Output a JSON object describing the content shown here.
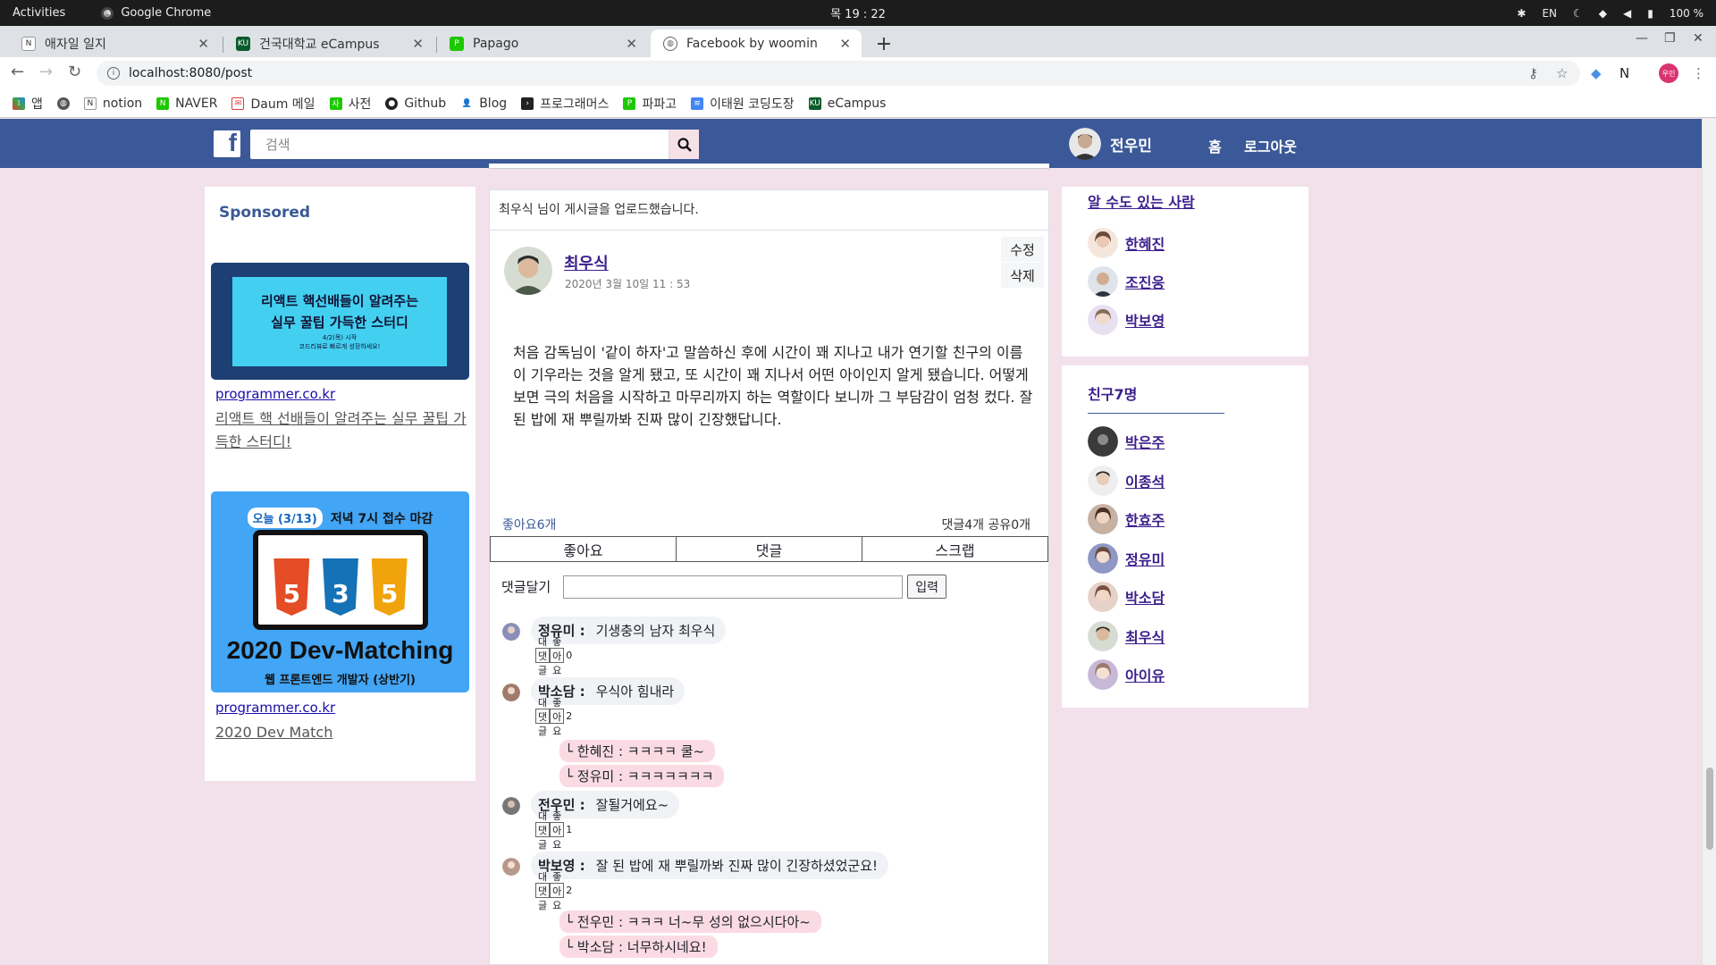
{
  "system": {
    "activities": "Activities",
    "app": "Google Chrome",
    "clock": "목 19 : 22",
    "lang": "EN",
    "battery": "100 %"
  },
  "tabs": [
    {
      "title": "애자일 일지",
      "fav": "notion"
    },
    {
      "title": "건국대학교 eCampus",
      "fav": "KU"
    },
    {
      "title": "Papago",
      "fav": "P"
    },
    {
      "title": "Facebook by woomin",
      "fav": "globe"
    }
  ],
  "address": {
    "url": "localhost:8080/post"
  },
  "bookmarks": [
    "앱",
    "notion",
    "NAVER",
    "Daum 메일",
    "사전",
    "Github",
    "Blog",
    "프로그래머스",
    "파파고",
    "이태원 코딩도장",
    "eCampus"
  ],
  "header": {
    "logo": "f",
    "search_placeholder": "검색",
    "user_name": "전우민",
    "nav_home": "홈",
    "nav_logout": "로그아웃"
  },
  "sponsored": {
    "title": "Sponsored",
    "ads": [
      {
        "banner_line1": "리액트 핵선배들이 알려주는",
        "banner_line2": "실무 꿀팁 가득한 스터디",
        "banner_small1": "4/2(목) 시작",
        "banner_small2": "코드리뷰로 빠르게 성장하세요!",
        "link": "programmer.co.kr",
        "desc": "리액트 핵 선배들이 알려주는 실무 꿀팁 가득한 스터디!"
      },
      {
        "banner_pill": "오늘 (3/13)",
        "banner_deadline": "저녁 7시 접수 마감",
        "badges": [
          "HTML",
          "CSS",
          "JS"
        ],
        "banner_big": "2020 Dev-Matching",
        "banner_sub": "웹 프론트엔드 개발자 (상반기)",
        "link": "programmer.co.kr",
        "desc": "2020 Dev Match"
      }
    ]
  },
  "post": {
    "notice": "최우식 님이 게시글을 업로드했습니다.",
    "author": "최우식",
    "date": "2020년 3월 10일    11 : 53",
    "edit": "수정",
    "delete": "삭제",
    "body": "처음 감독님이 '같이 하자'고 말씀하신 후에 시간이 꽤 지나고 내가 연기할 친구의 이름이 기우라는 것을 알게 됐고, 또 시간이 꽤 지나서 어떤 아이인지 알게 됐습니다. 어떻게 보면 극의 처음을 시작하고 마무리까지 하는 역할이다 보니까 그 부담감이 엄청 컸다. 잘 된 밥에 재 뿌릴까봐 진짜 많이 긴장했답니다.",
    "likes": "좋아요6개",
    "counts": "댓글4개 공유0개",
    "actions": [
      "좋아요",
      "댓글",
      "스크랩"
    ],
    "comment_label": "댓글달기",
    "comment_submit": "입력",
    "reply_btn": "대댓글",
    "like_btn": "좋아요",
    "comments": [
      {
        "name": "정유미 :",
        "text": "기생충의 남자 최우식",
        "likes": "0",
        "replies": []
      },
      {
        "name": "박소담 :",
        "text": "우식아 힘내라",
        "likes": "2",
        "replies": [
          "└ 한혜진 : ㅋㅋㅋㅋ 쿨~",
          "└ 정유미 : ㅋㅋㅋㅋㅋㅋㅋ"
        ]
      },
      {
        "name": "전우민 :",
        "text": "잘될거에요~",
        "likes": "1",
        "replies": []
      },
      {
        "name": "박보영 :",
        "text": "잘 된 밥에 재 뿌릴까봐 진짜 많이 긴장하셨었군요!",
        "likes": "2",
        "replies": [
          "└ 전우민 : ㅋㅋㅋ 너~무 성의 없으시다아~",
          "└ 박소담 : 너무하시네요!"
        ]
      }
    ]
  },
  "suggestions": {
    "title": "알 수도 있는 사람",
    "people": [
      "한혜진",
      "조진웅",
      "박보영"
    ]
  },
  "friends": {
    "title": "친구7명",
    "people": [
      "박은주",
      "이종석",
      "한효주",
      "정유미",
      "박소담",
      "최우식",
      "아이유"
    ]
  },
  "colors": {
    "fb_blue": "#3b5998",
    "page_bg": "#f2e1ea",
    "reply_bg": "#fbdbe3",
    "link_purple": "#3b1e8c"
  }
}
